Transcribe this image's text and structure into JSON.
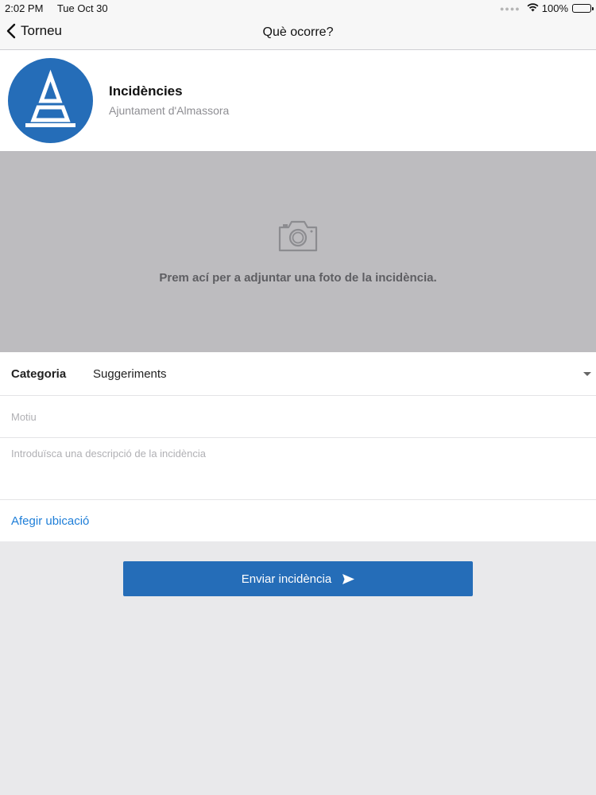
{
  "status_bar": {
    "time": "2:02 PM",
    "date": "Tue Oct 30",
    "battery": "100%",
    "battery_level": 1.0,
    "icons": [
      "wifi-icon",
      "battery-icon"
    ]
  },
  "nav": {
    "back_label": "Torneu",
    "title": "Què ocorre?"
  },
  "header": {
    "app_name": "Incidències",
    "organization": "Ajuntament d'Almassora"
  },
  "photo": {
    "hint": "Prem ací per a adjuntar una foto de la incidència.",
    "icon": "camera-icon"
  },
  "form": {
    "category_label": "Categoria",
    "category_value": "Suggeriments",
    "motiu_placeholder": "Motiu",
    "description_placeholder": "Introduïsca una descripció de la incidència",
    "location_link": "Afegir ubicació"
  },
  "submit": {
    "label": "Enviar incidència",
    "icon": "send-icon"
  },
  "colors": {
    "primary": "#256db8",
    "link": "#1e7ed8",
    "photo_bg": "#bdbcbf",
    "page_bg": "#e9e9eb"
  }
}
